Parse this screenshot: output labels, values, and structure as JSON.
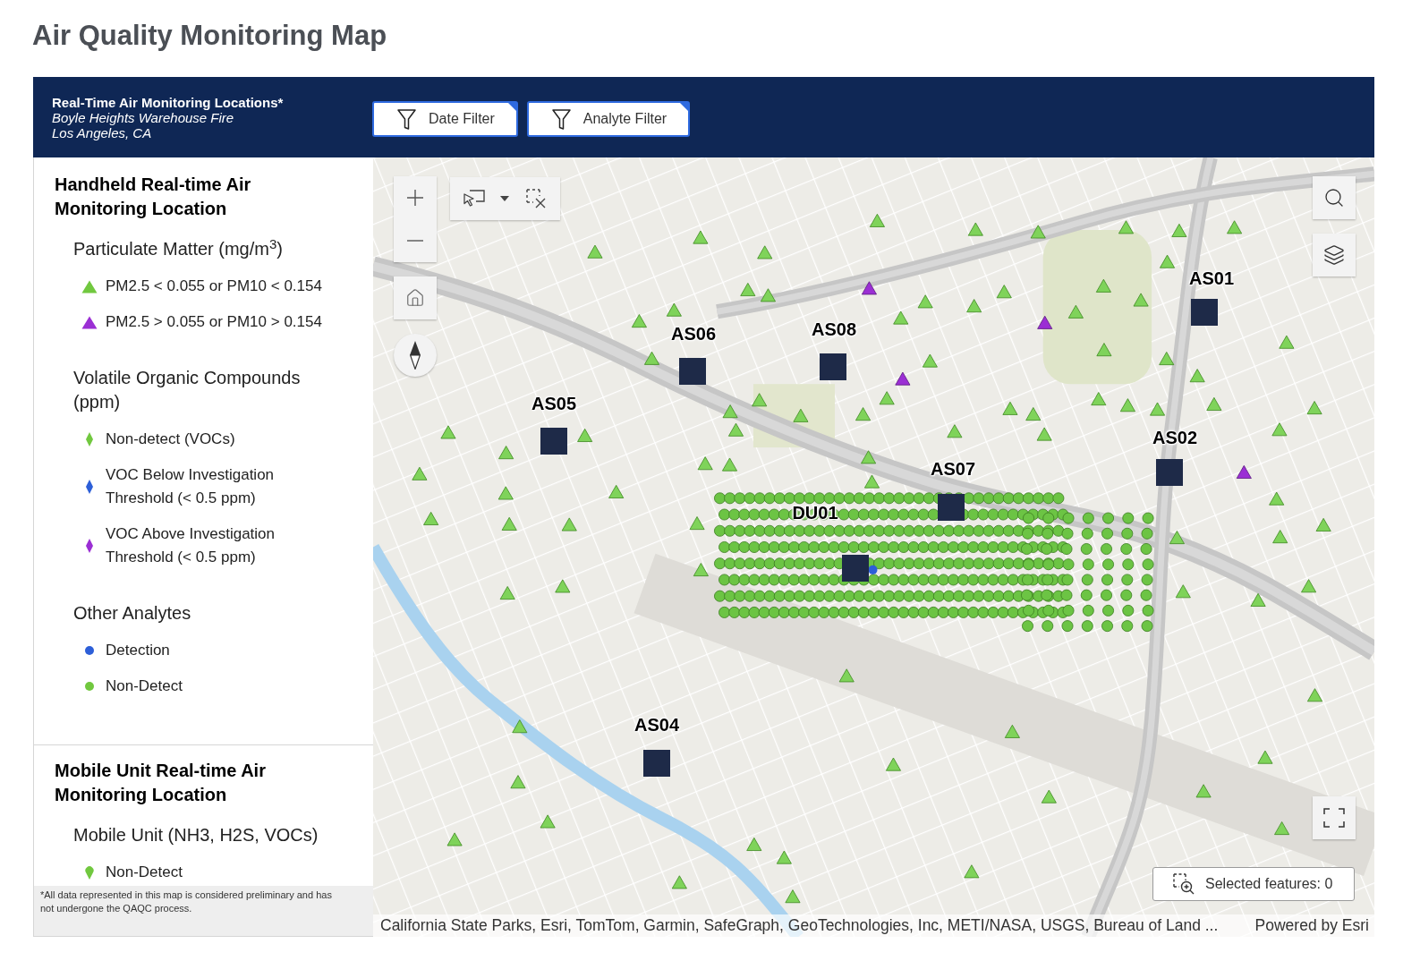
{
  "page": {
    "title": "Air Quality Monitoring Map"
  },
  "header": {
    "title": "Real-Time Air Monitoring Locations*",
    "subtitle": [
      "Boyle Heights Warehouse Fire",
      "Los Angeles, CA"
    ],
    "filters": [
      {
        "label": "Date Filter"
      },
      {
        "label": "Analyte Filter"
      }
    ]
  },
  "legend": {
    "sections": [
      {
        "title": "Handheld Real-time Air Monitoring Location",
        "groups": [
          {
            "title": "Particulate Matter (mg/m$^{3}$)",
            "items": [
              {
                "kind": "triangle",
                "color": "#71c83f",
                "label": "PM2.5 < 0.055 or PM10 < 0.154"
              },
              {
                "kind": "triangle",
                "color": "#9b2fd4",
                "label": "PM2.5 > 0.055 or PM10 > 0.154"
              }
            ]
          },
          {
            "title": "Volatile Organic Compounds (ppm)",
            "items": [
              {
                "kind": "diamond",
                "color": "#71c83f",
                "label": "Non-detect (VOCs)"
              },
              {
                "kind": "diamond",
                "color": "#2d5fd8",
                "label": "VOC Below Investigation Threshold (< 0.5 ppm)"
              },
              {
                "kind": "diamond",
                "color": "#9b2fd4",
                "label": "VOC Above Investigation Threshold (< 0.5 ppm)"
              }
            ]
          },
          {
            "title": "Other Analytes",
            "items": [
              {
                "kind": "dot",
                "color": "#2d5fd8",
                "label": "Detection"
              },
              {
                "kind": "dot",
                "color": "#71c83f",
                "label": "Non-Detect"
              }
            ]
          }
        ]
      },
      {
        "title": "Mobile Unit Real-time Air Monitoring Location",
        "groups": [
          {
            "title": "Mobile Unit (NH3, H2S, VOCs)",
            "items": [
              {
                "kind": "pin",
                "color": "#71c83f",
                "label": "Non-Detect"
              }
            ]
          }
        ]
      }
    ],
    "note": "*All data represented in this map is considered preliminary and has not undergone the QAQC process."
  },
  "map": {
    "stations": [
      {
        "label": "AS01"
      },
      {
        "label": "AS08"
      },
      {
        "label": "AS06"
      },
      {
        "label": "AS05"
      },
      {
        "label": "AS02"
      },
      {
        "label": "AS07"
      },
      {
        "label": "DU01"
      },
      {
        "label": "AS04"
      }
    ],
    "selected_features": "Selected features: 0",
    "attribution": "California State Parks, Esri, TomTom, Garmin, SafeGraph, GeoTechnologies, Inc, METI/NASA, USGS, Bureau of Land ...",
    "powered_by": "Powered by Esri"
  }
}
